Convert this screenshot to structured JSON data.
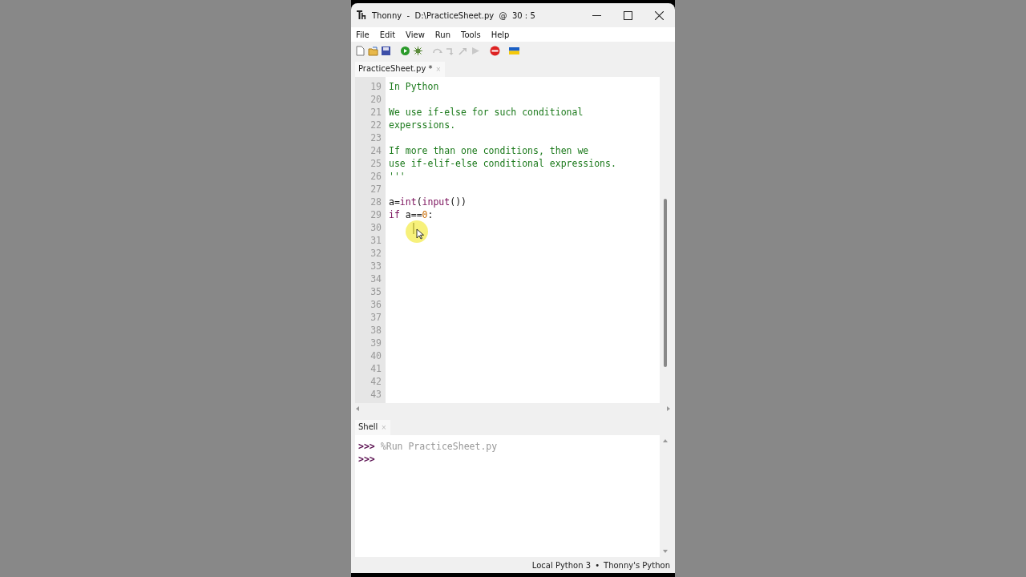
{
  "window": {
    "title": "Thonny  -  D:\\PracticeSheet.py  @  30 : 5"
  },
  "menu": [
    "File",
    "Edit",
    "View",
    "Run",
    "Tools",
    "Help"
  ],
  "toolbar": [
    {
      "kind": "new",
      "disabled": false
    },
    {
      "kind": "open",
      "disabled": false
    },
    {
      "kind": "save",
      "disabled": false
    },
    {
      "kind": "run",
      "disabled": false
    },
    {
      "kind": "debug",
      "disabled": false
    },
    {
      "kind": "step-over",
      "disabled": true
    },
    {
      "kind": "step-into",
      "disabled": true
    },
    {
      "kind": "step-out",
      "disabled": true
    },
    {
      "kind": "resume",
      "disabled": true
    },
    {
      "kind": "stop",
      "disabled": false
    },
    {
      "kind": "flag",
      "disabled": false
    }
  ],
  "editor_tabs": [
    {
      "label": "PracticeSheet.py *",
      "close": "×",
      "selected": true
    }
  ],
  "code_lines": [
    {
      "number": "19",
      "tokens": [
        {
          "kind": "string",
          "text": "In Python"
        }
      ]
    },
    {
      "number": "20"
    },
    {
      "number": "21",
      "tokens": [
        {
          "kind": "string",
          "text": "We use if-else for such conditional"
        }
      ]
    },
    {
      "number": "22",
      "tokens": [
        {
          "kind": "string",
          "text": "experssions."
        }
      ]
    },
    {
      "number": "23"
    },
    {
      "number": "24",
      "tokens": [
        {
          "kind": "string",
          "text": "If more than one conditions, then we"
        }
      ]
    },
    {
      "number": "25",
      "tokens": [
        {
          "kind": "string",
          "text": "use if-elif-else conditional expressions."
        }
      ]
    },
    {
      "number": "26",
      "tokens": [
        {
          "kind": "string",
          "text": "'''"
        }
      ]
    },
    {
      "number": "27"
    },
    {
      "number": "28",
      "tokens": [
        {
          "kind": "plain",
          "text": "a="
        },
        {
          "kind": "builtin",
          "text": "int"
        },
        {
          "kind": "plain",
          "text": "("
        },
        {
          "kind": "builtin",
          "text": "input"
        },
        {
          "kind": "plain",
          "text": "())"
        }
      ]
    },
    {
      "number": "29",
      "tokens": [
        {
          "kind": "keyword",
          "text": "if"
        },
        {
          "kind": "plain",
          "text": " a=="
        },
        {
          "kind": "number",
          "text": "0"
        },
        {
          "kind": "plain",
          "text": ":"
        }
      ]
    },
    {
      "number": "30"
    },
    {
      "number": "31"
    },
    {
      "number": "32"
    },
    {
      "number": "33"
    },
    {
      "number": "34"
    },
    {
      "number": "35"
    },
    {
      "number": "36"
    },
    {
      "number": "37"
    },
    {
      "number": "38"
    },
    {
      "number": "39"
    },
    {
      "number": "40"
    },
    {
      "number": "41"
    },
    {
      "number": "42"
    },
    {
      "number": "43"
    }
  ],
  "shell_tabs": [
    {
      "label": "Shell",
      "close": "×",
      "selected": true
    }
  ],
  "shell_lines": [
    {
      "prompt": ">>>",
      "text": "%Run PracticeSheet.py"
    },
    {
      "prompt": ">>>"
    }
  ],
  "status_bar": {
    "interpreter": "Local Python 3",
    "separator": "•",
    "python": "Thonny's Python"
  }
}
